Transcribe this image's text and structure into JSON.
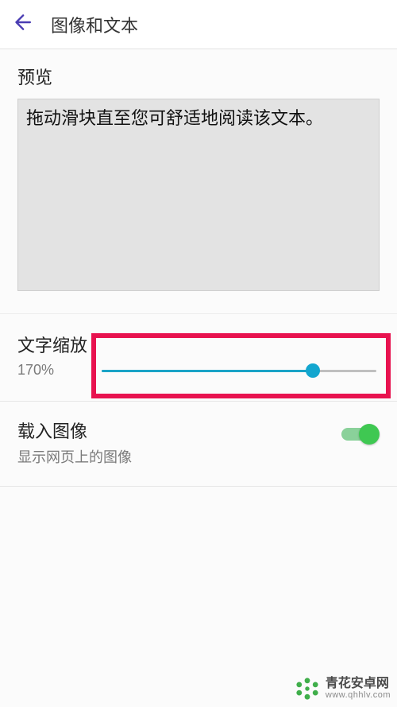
{
  "header": {
    "title": "图像和文本"
  },
  "preview": {
    "label": "预览",
    "sample_text": "拖动滑块直至您可舒适地阅读该文本。"
  },
  "text_scaling": {
    "label": "文字缩放",
    "value_text": "170%",
    "value_percent": 170,
    "slider_fill_percent": 77
  },
  "load_images": {
    "label": "载入图像",
    "subtitle": "显示网页上的图像",
    "enabled": true
  },
  "watermark": {
    "name_cn": "青花安卓网",
    "url": "www.qhhlv.com"
  },
  "colors": {
    "accent_back_arrow": "#4a3db3",
    "slider_active": "#1aa3c7",
    "toggle_on": "#3fc852",
    "highlight": "#e8124f"
  }
}
